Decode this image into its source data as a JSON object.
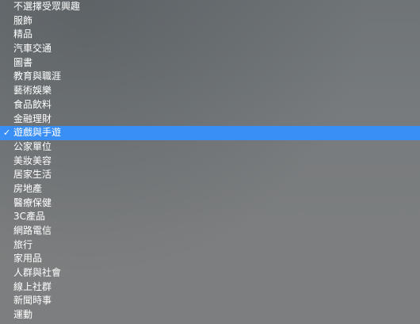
{
  "dropdown": {
    "selected_index": 10,
    "check_glyph": "✓",
    "items": [
      {
        "label": "不選擇受眾興趣"
      },
      {
        "label": "服飾"
      },
      {
        "label": "精品"
      },
      {
        "label": "汽車交通"
      },
      {
        "label": "圖書"
      },
      {
        "label": "教育與職涯"
      },
      {
        "label": "藝術娛樂"
      },
      {
        "label": "食品飲料"
      },
      {
        "label": "金融理財"
      },
      {
        "label": "遊戲與手遊"
      },
      {
        "label": "公家單位"
      },
      {
        "label": "美妝美容"
      },
      {
        "label": "居家生活"
      },
      {
        "label": "房地產"
      },
      {
        "label": "醫療保健"
      },
      {
        "label": "3C產品"
      },
      {
        "label": "網路電信"
      },
      {
        "label": "旅行"
      },
      {
        "label": "家用品"
      },
      {
        "label": "人群與社會"
      },
      {
        "label": "線上社群"
      },
      {
        "label": "新聞時事"
      },
      {
        "label": "運動"
      }
    ],
    "highlight_color": "#3a8ff6"
  }
}
